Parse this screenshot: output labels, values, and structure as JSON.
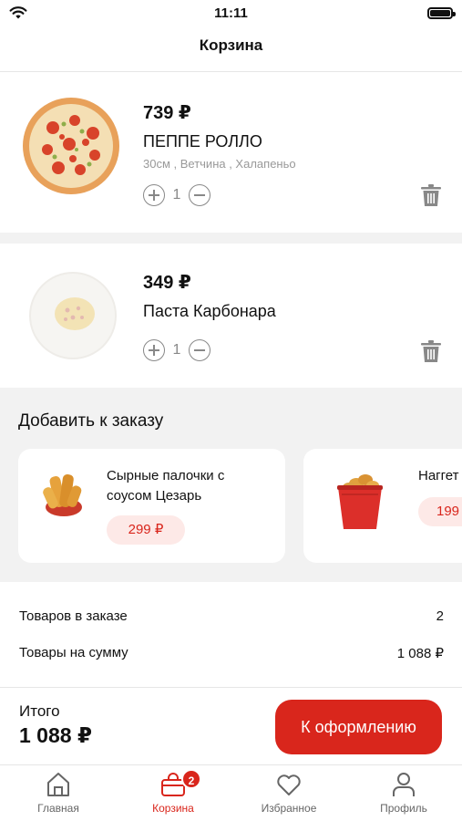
{
  "status_bar": {
    "time": "11:11"
  },
  "header": {
    "title": "Корзина"
  },
  "cart_items": [
    {
      "price": "739 ₽",
      "name": "ПЕППЕ РОЛЛО",
      "options": "30см ,  Ветчина ,  Халапеньо",
      "quantity": "1",
      "image": "pizza"
    },
    {
      "price": "349 ₽",
      "name": "Паста Карбонара",
      "options": "",
      "quantity": "1",
      "image": "pasta"
    }
  ],
  "upsell": {
    "title": "Добавить к заказу",
    "items": [
      {
        "name": "Сырные палочки с соусом Цезарь",
        "price": "299 ₽",
        "image": "cheese-sticks"
      },
      {
        "name": "Наггет",
        "price": "199",
        "image": "nuggets-bucket"
      }
    ]
  },
  "summary": {
    "items_count_label": "Товаров в заказе",
    "items_count_value": "2",
    "items_sum_label": "Товары на сумму",
    "items_sum_value": "1 088 ₽"
  },
  "footer": {
    "total_label": "Итого",
    "total_value": "1 088 ₽",
    "checkout_label": "К оформлению"
  },
  "tabbar": {
    "items": [
      {
        "label": "Главная",
        "icon": "home-icon"
      },
      {
        "label": "Корзина",
        "icon": "bag-icon",
        "badge": "2",
        "active": true
      },
      {
        "label": "Избранное",
        "icon": "heart-icon"
      },
      {
        "label": "Профиль",
        "icon": "person-icon"
      }
    ]
  },
  "colors": {
    "accent": "#d9261c",
    "accent_soft": "#fde9e7",
    "band": "#f2f2f2"
  }
}
